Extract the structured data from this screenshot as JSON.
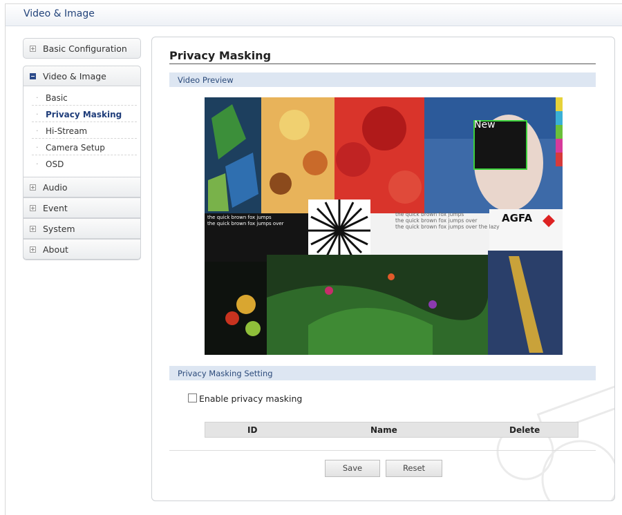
{
  "header": {
    "title": "Video & Image"
  },
  "sidebar": {
    "items": [
      {
        "label": "Basic Configuration"
      },
      {
        "label": "Video & Image"
      },
      {
        "label": "Audio"
      },
      {
        "label": "Event"
      },
      {
        "label": "System"
      },
      {
        "label": "About"
      }
    ],
    "subitems": [
      {
        "label": "Basic"
      },
      {
        "label": "Privacy Masking"
      },
      {
        "label": "Hi-Stream"
      },
      {
        "label": "Camera Setup"
      },
      {
        "label": "OSD"
      }
    ]
  },
  "main": {
    "title": "Privacy Masking",
    "preview_section": "Video Preview",
    "mask_label": "New",
    "settings_section": "Privacy Masking Setting",
    "enable_label": "Enable privacy masking",
    "enable_checked": false,
    "table": {
      "columns": [
        "ID",
        "Name",
        "Delete"
      ]
    },
    "buttons": {
      "save": "Save",
      "reset": "Reset"
    }
  },
  "video_text": {
    "fox_left_1": "the quick brown fox jumps",
    "fox_left_2": "the quick brown fox jumps over",
    "fox_right_1": "the quick brown fox jumps",
    "fox_right_2": "the quick brown fox jumps over",
    "fox_right_3": "the quick brown fox jumps over the lazy",
    "brand": "AGFA"
  },
  "colors": {
    "accent": "#22437a",
    "section_bar": "#dde6f2",
    "mask_border": "#3bd13b"
  },
  "icons": {
    "expand": "plus-box-icon",
    "collapse": "minus-box-icon"
  }
}
